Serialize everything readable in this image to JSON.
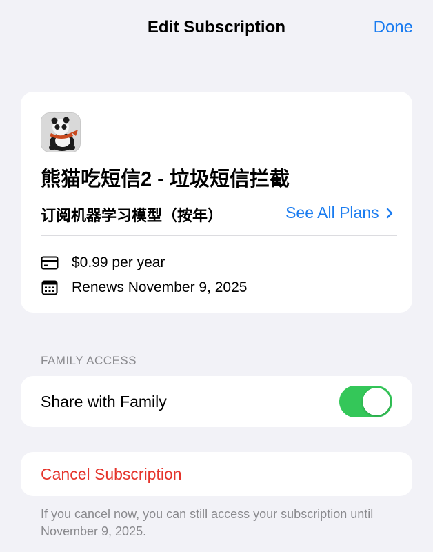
{
  "nav": {
    "title": "Edit Subscription",
    "done_label": "Done"
  },
  "app": {
    "icon": "panda-app-icon",
    "name": "熊猫吃短信2 - 垃圾短信拦截",
    "plan": "订阅机器学习模型（按年）",
    "see_all_plans_label": "See All Plans",
    "price": "$0.99 per year",
    "renewal": "Renews November 9, 2025"
  },
  "family": {
    "section_header": "FAMILY ACCESS",
    "share_label": "Share with Family",
    "share_enabled": true
  },
  "cancel": {
    "label": "Cancel Subscription",
    "note": "If you cancel now, you can still access your subscription until November 9, 2025."
  },
  "colors": {
    "accent": "#1a7cf0",
    "toggle_on": "#34c759",
    "destructive": "#e5342b",
    "background": "#f2f2f7",
    "secondary_text": "#8a8a8e"
  }
}
